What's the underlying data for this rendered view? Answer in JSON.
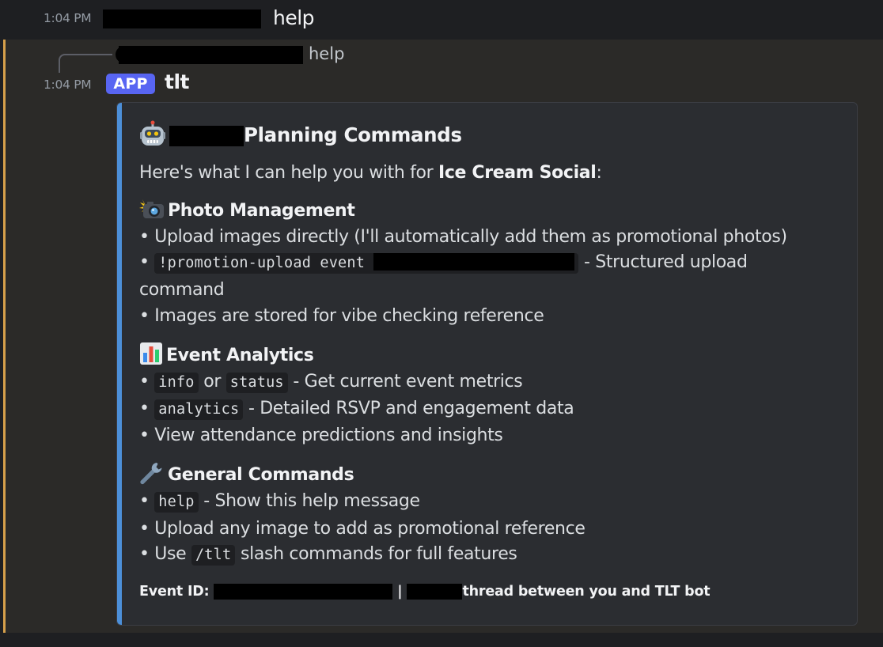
{
  "message1": {
    "timestamp": "1:04 PM",
    "text": "help"
  },
  "message2": {
    "reply": {
      "text": "help"
    },
    "timestamp": "1:04 PM",
    "badge": "APP",
    "author": "tlt",
    "embed": {
      "title_suffix": "Planning Commands",
      "intro_prefix": "Here's what I can help you with for ",
      "intro_event": "Ice Cream Social",
      "intro_suffix": ":",
      "sections": {
        "photo": {
          "heading": "Photo Management",
          "icon": "camera-flash-icon",
          "line1": "• Upload images directly (I'll automatically add them as promotional photos)",
          "line2_bullet": "• ",
          "line2_code": "!promotion-upload event ",
          "line2_suffix": " - Structured upload",
          "line2_wrap": "command",
          "line3": "• Images are stored for vibe checking reference"
        },
        "analytics": {
          "heading": "Event Analytics",
          "icon": "bar-chart-icon",
          "bullet": "• ",
          "code_info": "info",
          "or_text": " or ",
          "code_status": "status",
          "line1_suffix": " - Get current event metrics",
          "code_analytics": "analytics",
          "line2_suffix": " - Detailed RSVP and engagement data",
          "line3": "• View attendance predictions and insights"
        },
        "general": {
          "heading": "General Commands",
          "icon": "wrench-icon",
          "bullet": "• ",
          "code_help": "help",
          "line1_suffix": " - Show this help message",
          "line2": "• Upload any image to add as promotional reference",
          "line3_prefix": "• Use ",
          "code_tlt": "/tlt",
          "line3_suffix": " slash commands for full features"
        }
      },
      "footer": {
        "label": "Event ID: ",
        "separator": "|",
        "suffix": "thread between you and TLT bot"
      }
    }
  },
  "colors": {
    "background": "#1e1f22",
    "highlight_background": "#2b2a28",
    "mention_bar": "#d6a04b",
    "embed_background": "#2b2d31",
    "embed_stripe": "#4c8fd8",
    "app_badge": "#5865f2"
  }
}
